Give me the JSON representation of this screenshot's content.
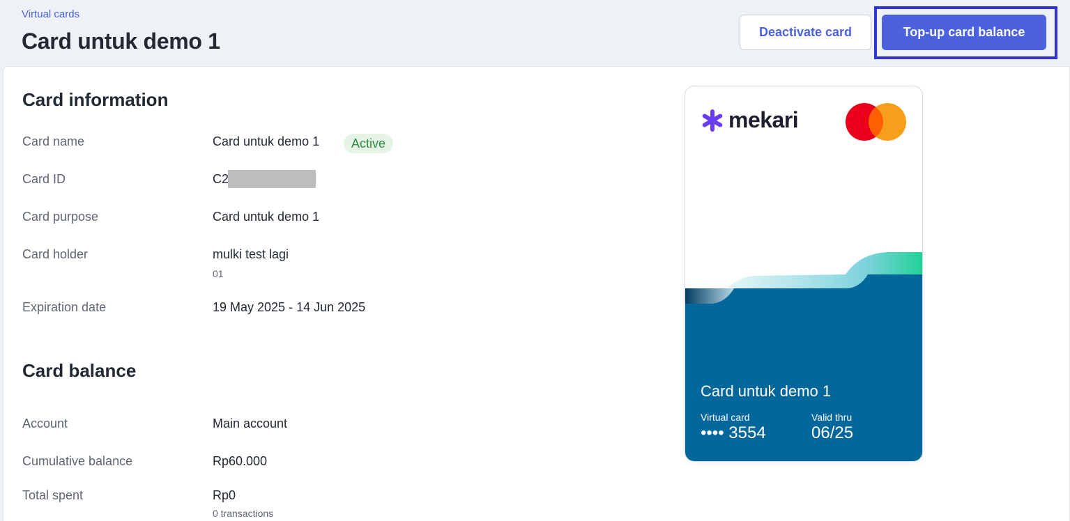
{
  "header": {
    "breadcrumb": "Virtual cards",
    "title": "Card untuk demo 1",
    "deactivate_label": "Deactivate card",
    "topup_label": "Top-up card balance"
  },
  "card_information": {
    "title": "Card information",
    "rows": {
      "card_name": {
        "label": "Card name",
        "value": "Card untuk demo 1",
        "status": "Active"
      },
      "card_id": {
        "label": "Card ID",
        "value": "C2"
      },
      "card_purpose": {
        "label": "Card purpose",
        "value": "Card untuk demo 1"
      },
      "card_holder": {
        "label": "Card holder",
        "value": "mulki test lagi",
        "sub": "01"
      },
      "expiration": {
        "label": "Expiration date",
        "value": "19 May 2025 - 14 Jun 2025"
      }
    }
  },
  "card_balance": {
    "title": "Card balance",
    "rows": {
      "account": {
        "label": "Account",
        "value": "Main account"
      },
      "cumulative": {
        "label": "Cumulative balance",
        "value": "Rp60.000"
      },
      "spent": {
        "label": "Total spent",
        "value": "Rp0",
        "sub": "0 transactions"
      }
    }
  },
  "card_visual": {
    "brand": "mekari",
    "name": "Card untuk demo 1",
    "type_label": "Virtual card",
    "number": "•••• 3554",
    "valid_label": "Valid thru",
    "valid_value": "06/25"
  },
  "colors": {
    "accent": "#4b61dd",
    "card_blue": "#04679c",
    "active_bg": "#e6f4e8",
    "active_text": "#2e8b3e",
    "mastercard_red": "#eb001b",
    "mastercard_orange": "#f79e1b"
  }
}
